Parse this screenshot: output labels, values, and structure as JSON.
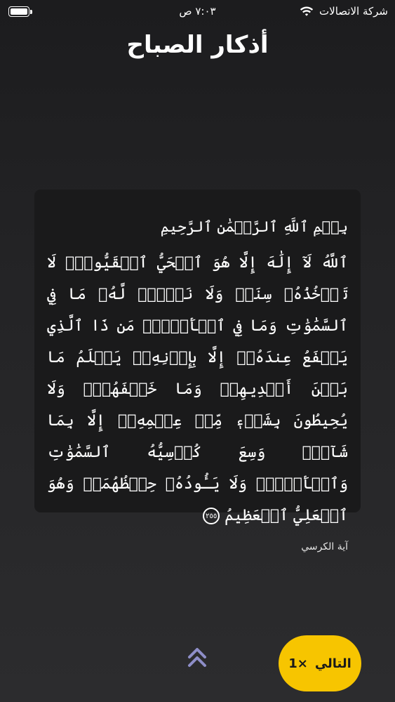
{
  "status_bar": {
    "carrier": "شركة الاتصالات",
    "time": "٧:٠٣ ص",
    "battery_level": 1.0
  },
  "page": {
    "title": "أذكار الصباح"
  },
  "dhikr": {
    "basmala": "بِسۡمِ ٱللَّهِ ٱلرَّحۡمَٰنِ ٱلرَّحِيمِ",
    "text": "ٱللَّهُ لَآ إِلَٰهَ إِلَّا هُوَ ٱلۡحَيُّ ٱلۡقَيُّومُۚ لَا تَأۡخُذُهُۥ سِنَةٞ وَلَا نَوۡمٞۚ لَّهُۥ مَا فِي ٱلسَّمَٰوَٰتِ وَمَا فِي ٱلۡأَرۡضِۗ مَن ذَا ٱلَّذِي يَشۡفَعُ عِندَهُۥٓ إِلَّا بِإِذۡنِهِۦۚ يَعۡلَمُ مَا بَيۡنَ أَيۡدِيهِمۡ وَمَا خَلۡفَهُمۡۖ وَلَا يُحِيطُونَ بِشَيۡءٖ مِّنۡ عِلۡمِهِۦٓ إِلَّا بِمَا شَآءَۚ وَسِعَ كُرۡسِيُّهُ ٱلسَّمَٰوَٰتِ وَٱلۡأَرۡضَۖ وَلَا يَـُٔودُهُۥ حِفۡظُهُمَاۚ وَهُوَ ٱلۡعَلِيُّ ٱلۡعَظِيمُ",
    "verse_number": "٢٥٥",
    "source": "آية الكرسي"
  },
  "controls": {
    "next_label": "التالي",
    "count_label": "×1",
    "scroll_up_icon": "double-chevron-up-icon",
    "accent_color": "#f7c500"
  }
}
